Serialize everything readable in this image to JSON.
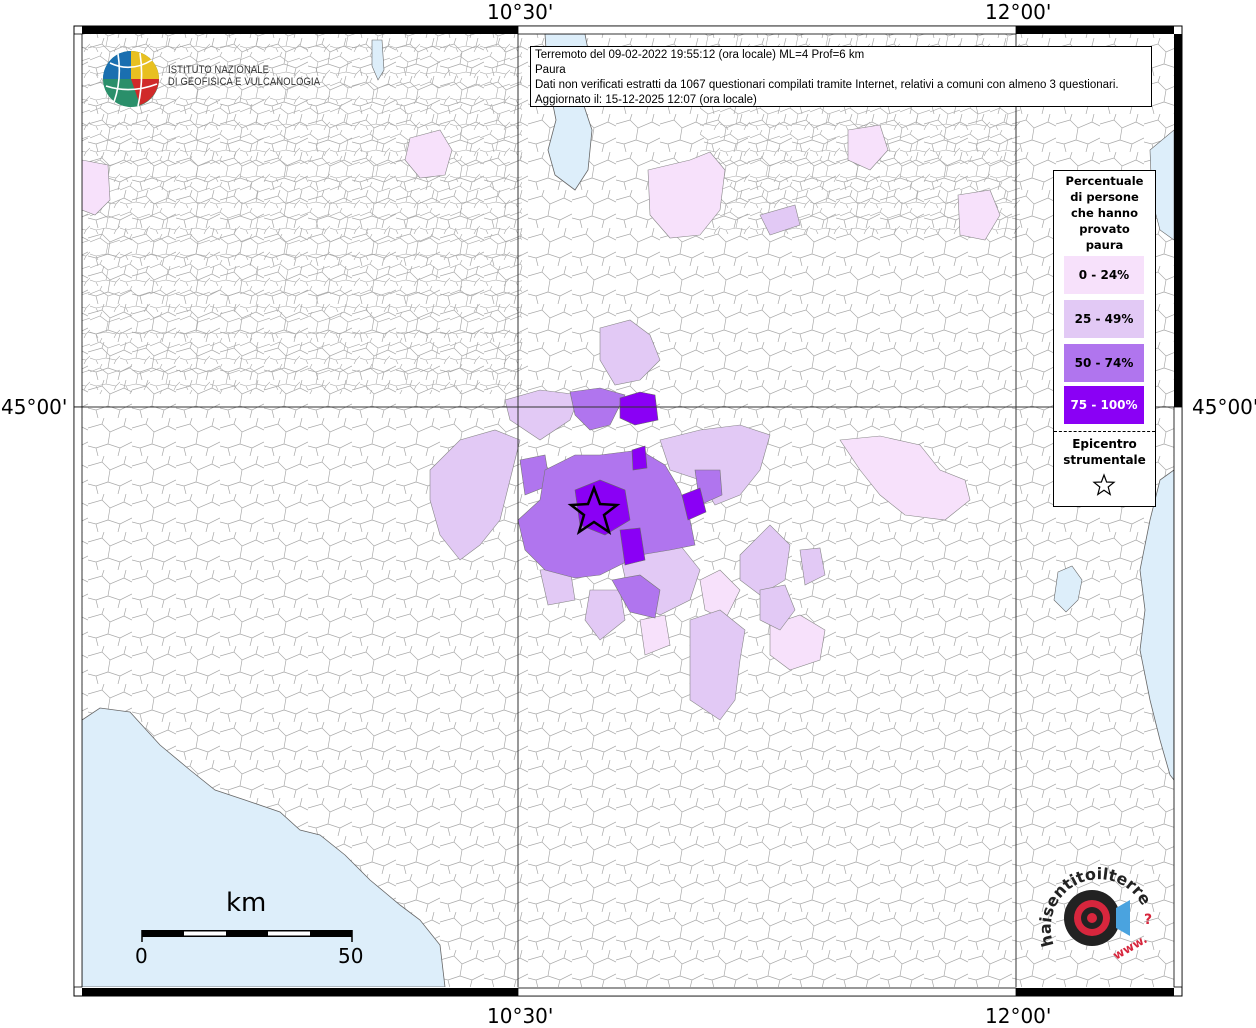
{
  "header": {
    "line1": "Terremoto del 09-02-2022 19:55:12 (ora locale) ML=4 Prof=6 km",
    "line2": "Paura",
    "line3": "Dati non verificati estratti da 1067 questionari compilati tramite Internet, relativi a comuni con almeno 3 questionari.",
    "line4": "Aggiornato il: 15-12-2025 12:07 (ora locale)"
  },
  "coords": {
    "top_left_lon": "10°30'",
    "top_right_lon": "12°00'",
    "bottom_left_lon": "10°30'",
    "bottom_right_lon": "12°00'",
    "left_lat": "45°00'",
    "right_lat": "45°00'"
  },
  "logo": {
    "ingv_line1": "ISTITUTO NAZIONALE",
    "ingv_line2": "DI GEOFISICA E VULCANOLOGIA",
    "hst_text": "haisentitoilterremoto.it",
    "hst_www": "www.",
    "hst_question": "?"
  },
  "legend": {
    "title": [
      "Percentuale",
      "di persone",
      "che hanno",
      "provato",
      "paura"
    ],
    "classes": [
      {
        "label": "0 - 24%",
        "color": "#f7e1fb"
      },
      {
        "label": "25 - 49%",
        "color": "#e2c9f5"
      },
      {
        "label": "50 - 74%",
        "color": "#b075ee"
      },
      {
        "label": "75 - 100%",
        "color": "#8a00f5"
      }
    ],
    "epicenter_title_1": "Epicentro",
    "epicenter_title_2": "strumentale"
  },
  "scale": {
    "unit": "km",
    "min": "0",
    "max": "50"
  },
  "colors": {
    "sea": "#ddeefa",
    "land": "#ffffff",
    "border": "#999999",
    "frame": "#000000"
  }
}
